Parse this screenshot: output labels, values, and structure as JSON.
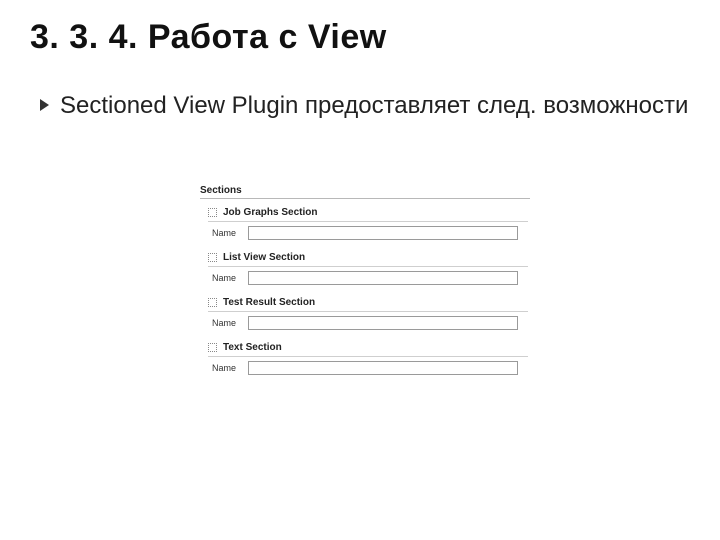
{
  "title": "3. 3. 4. Работа с View",
  "bullet_text": "Sectioned View Plugin предоставляет след. возможности",
  "shot": {
    "heading": "Sections",
    "sections": [
      {
        "title": "Job Graphs Section",
        "field_label": "Name",
        "field_value": ""
      },
      {
        "title": "List View Section",
        "field_label": "Name",
        "field_value": ""
      },
      {
        "title": "Test Result Section",
        "field_label": "Name",
        "field_value": ""
      },
      {
        "title": "Text Section",
        "field_label": "Name",
        "field_value": ""
      }
    ]
  }
}
